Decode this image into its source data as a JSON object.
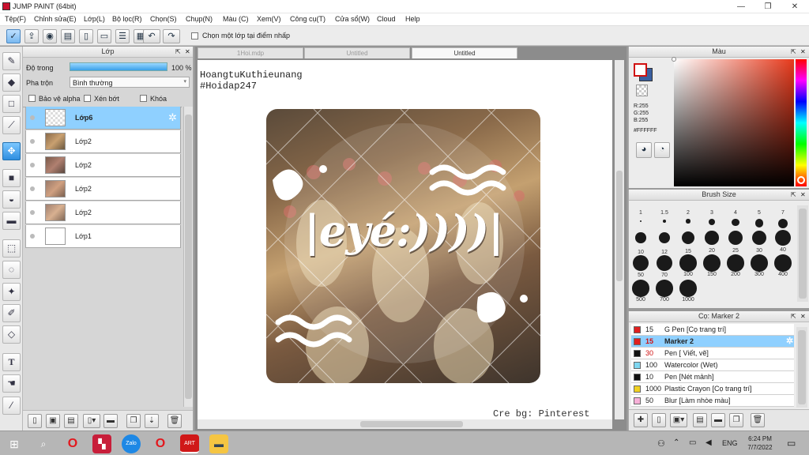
{
  "window": {
    "title": "JUMP PAINT (64bit)",
    "minimize": "—",
    "restore": "❐",
    "close": "✕"
  },
  "menu": [
    "Tệp(F)",
    "Chỉnh sửa(E)",
    "Lớp(L)",
    "Bộ lọc(R)",
    "Chọn(S)",
    "Chụp(N)",
    "Màu (C)",
    "Xem(V)",
    "Công cụ(T)",
    "Cửa sổ(W)",
    "Cloud",
    "Help"
  ],
  "toolbar": {
    "select_layer_label": "Chọn một lớp tại điểm nhấp"
  },
  "layers_panel": {
    "title": "Lớp",
    "opacity_label": "Độ trong",
    "opacity_value": "100 %",
    "opacity_fraction": 1.0,
    "blend_label": "Pha trộn",
    "blend_value": "Bình thường",
    "protect_alpha": "Bảo vệ alpha",
    "clipping": "Xén bớt",
    "lock": "Khóa",
    "layers": [
      {
        "name": "Lớp6",
        "selected": true,
        "thumb": "transparent"
      },
      {
        "name": "Lớp2",
        "selected": false,
        "thumb": "photo"
      },
      {
        "name": "Lớp2",
        "selected": false,
        "thumb": "photo"
      },
      {
        "name": "Lớp2",
        "selected": false,
        "thumb": "photo"
      },
      {
        "name": "Lớp2",
        "selected": false,
        "thumb": "photo"
      },
      {
        "name": "Lớp1",
        "selected": false,
        "thumb": "white"
      }
    ]
  },
  "canvas": {
    "tabs": [
      "1Hoi.mdp",
      "Untitled",
      "Untitled"
    ],
    "active_tab": 2,
    "text_line1": "HoangtuKuthieunang",
    "text_line2": "#Hoidap247",
    "artwork_text": "|eyé:))))|",
    "credit": "Cre bg: Pinterest"
  },
  "color_panel": {
    "title": "Màu",
    "r": "R:255",
    "g": "G:255",
    "b": "B:255",
    "hex": "#FFFFFF"
  },
  "brush_panel": {
    "title": "Brush Size",
    "sizes": [
      "1",
      "1.5",
      "2",
      "3",
      "4",
      "5",
      "7",
      "10",
      "12",
      "15",
      "20",
      "25",
      "30",
      "40",
      "50",
      "70",
      "100",
      "150",
      "200",
      "300",
      "400",
      "500",
      "700",
      "1000"
    ]
  },
  "pen_panel": {
    "title": "Cọ: Marker 2",
    "items": [
      {
        "size": "15",
        "name": "G Pen [Cọ trang trí]",
        "color": "#e02020",
        "selected": false
      },
      {
        "size": "15",
        "name": "Marker 2",
        "color": "#e02020",
        "selected": true
      },
      {
        "size": "30",
        "name": "Pen [ Viết, vẽ]",
        "color": "#111111",
        "selected": false
      },
      {
        "size": "100",
        "name": "Watercolor (Wet)",
        "color": "#7fd6f0",
        "selected": false
      },
      {
        "size": "10",
        "name": "Pen [Nét mảnh]",
        "color": "#111111",
        "selected": false
      },
      {
        "size": "1000",
        "name": "Plastic Crayon [Cọ trang trí]",
        "color": "#f0d020",
        "selected": false
      },
      {
        "size": "50",
        "name": "Blur [Làm nhòe màu]",
        "color": "#f8b0d8",
        "selected": false
      }
    ]
  },
  "taskbar": {
    "language": "ENG",
    "time": "6:24 PM",
    "date": "7/7/2022"
  }
}
